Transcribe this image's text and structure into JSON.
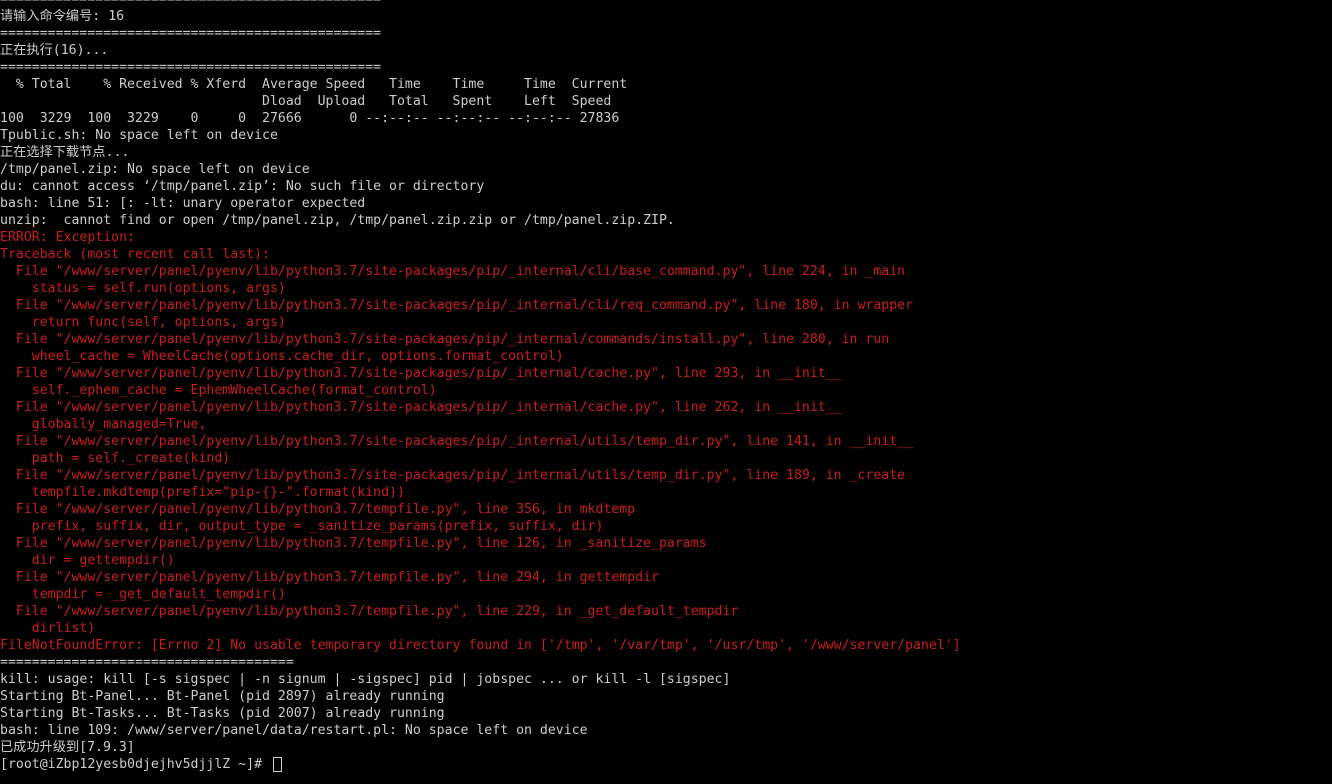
{
  "terminal": {
    "lines": [
      {
        "text": "================================================",
        "type": "normal"
      },
      {
        "text": "请输入命令编号: 16",
        "type": "normal"
      },
      {
        "text": "================================================",
        "type": "normal"
      },
      {
        "text": "正在执行(16)...",
        "type": "normal"
      },
      {
        "text": "================================================",
        "type": "normal"
      },
      {
        "text": "  % Total    % Received % Xferd  Average Speed   Time    Time     Time  Current",
        "type": "normal"
      },
      {
        "text": "                                 Dload  Upload   Total   Spent    Left  Speed",
        "type": "normal"
      },
      {
        "text": "100  3229  100  3229    0     0  27666      0 --:--:-- --:--:-- --:--:-- 27836",
        "type": "normal"
      },
      {
        "text": "Tpublic.sh: No space left on device",
        "type": "normal"
      },
      {
        "text": "正在选择下载节点...",
        "type": "normal"
      },
      {
        "text": "/tmp/panel.zip: No space left on device",
        "type": "normal"
      },
      {
        "text": "du: cannot access ‘/tmp/panel.zip’: No such file or directory",
        "type": "normal"
      },
      {
        "text": "bash: line 51: [: -lt: unary operator expected",
        "type": "normal"
      },
      {
        "text": "unzip:  cannot find or open /tmp/panel.zip, /tmp/panel.zip.zip or /tmp/panel.zip.ZIP.",
        "type": "normal"
      },
      {
        "text": "ERROR: Exception:",
        "type": "error"
      },
      {
        "text": "Traceback (most recent call last):",
        "type": "error"
      },
      {
        "text": "  File \"/www/server/panel/pyenv/lib/python3.7/site-packages/pip/_internal/cli/base_command.py\", line 224, in _main",
        "type": "error"
      },
      {
        "text": "    status = self.run(options, args)",
        "type": "error"
      },
      {
        "text": "  File \"/www/server/panel/pyenv/lib/python3.7/site-packages/pip/_internal/cli/req_command.py\", line 180, in wrapper",
        "type": "error"
      },
      {
        "text": "    return func(self, options, args)",
        "type": "error"
      },
      {
        "text": "  File \"/www/server/panel/pyenv/lib/python3.7/site-packages/pip/_internal/commands/install.py\", line 280, in run",
        "type": "error"
      },
      {
        "text": "    wheel_cache = WheelCache(options.cache_dir, options.format_control)",
        "type": "error"
      },
      {
        "text": "  File \"/www/server/panel/pyenv/lib/python3.7/site-packages/pip/_internal/cache.py\", line 293, in __init__",
        "type": "error"
      },
      {
        "text": "    self._ephem_cache = EphemWheelCache(format_control)",
        "type": "error"
      },
      {
        "text": "  File \"/www/server/panel/pyenv/lib/python3.7/site-packages/pip/_internal/cache.py\", line 262, in __init__",
        "type": "error"
      },
      {
        "text": "    globally_managed=True,",
        "type": "error"
      },
      {
        "text": "  File \"/www/server/panel/pyenv/lib/python3.7/site-packages/pip/_internal/utils/temp_dir.py\", line 141, in __init__",
        "type": "error"
      },
      {
        "text": "    path = self._create(kind)",
        "type": "error"
      },
      {
        "text": "  File \"/www/server/panel/pyenv/lib/python3.7/site-packages/pip/_internal/utils/temp_dir.py\", line 189, in _create",
        "type": "error"
      },
      {
        "text": "    tempfile.mkdtemp(prefix=\"pip-{}-\".format(kind))",
        "type": "error"
      },
      {
        "text": "  File \"/www/server/panel/pyenv/lib/python3.7/tempfile.py\", line 356, in mkdtemp",
        "type": "error"
      },
      {
        "text": "    prefix, suffix, dir, output_type = _sanitize_params(prefix, suffix, dir)",
        "type": "error"
      },
      {
        "text": "  File \"/www/server/panel/pyenv/lib/python3.7/tempfile.py\", line 126, in _sanitize_params",
        "type": "error"
      },
      {
        "text": "    dir = gettempdir()",
        "type": "error"
      },
      {
        "text": "  File \"/www/server/panel/pyenv/lib/python3.7/tempfile.py\", line 294, in gettempdir",
        "type": "error"
      },
      {
        "text": "    tempdir = _get_default_tempdir()",
        "type": "error"
      },
      {
        "text": "  File \"/www/server/panel/pyenv/lib/python3.7/tempfile.py\", line 229, in _get_default_tempdir",
        "type": "error"
      },
      {
        "text": "    dirlist)",
        "type": "error"
      },
      {
        "text": "FileNotFoundError: [Errno 2] No usable temporary directory found in ['/tmp', '/var/tmp', '/usr/tmp', '/www/server/panel']",
        "type": "error"
      },
      {
        "text": "=====================================",
        "type": "normal"
      },
      {
        "text": "kill: usage: kill [-s sigspec | -n signum | -sigspec] pid | jobspec ... or kill -l [sigspec]",
        "type": "normal"
      },
      {
        "text": "Starting Bt-Panel... Bt-Panel (pid 2897) already running",
        "type": "normal"
      },
      {
        "text": "Starting Bt-Tasks... Bt-Tasks (pid 2007) already running",
        "type": "normal"
      },
      {
        "text": "bash: line 109: /www/server/panel/data/restart.pl: No space left on device",
        "type": "normal"
      },
      {
        "text": "已成功升级到[7.9.3]",
        "type": "normal"
      }
    ],
    "prompt": "[root@iZbp12yesb0djejhv5djjlZ ~]# ",
    "colors": {
      "background": "#000000",
      "foreground": "#cccccc",
      "error": "#c81e1e"
    }
  }
}
